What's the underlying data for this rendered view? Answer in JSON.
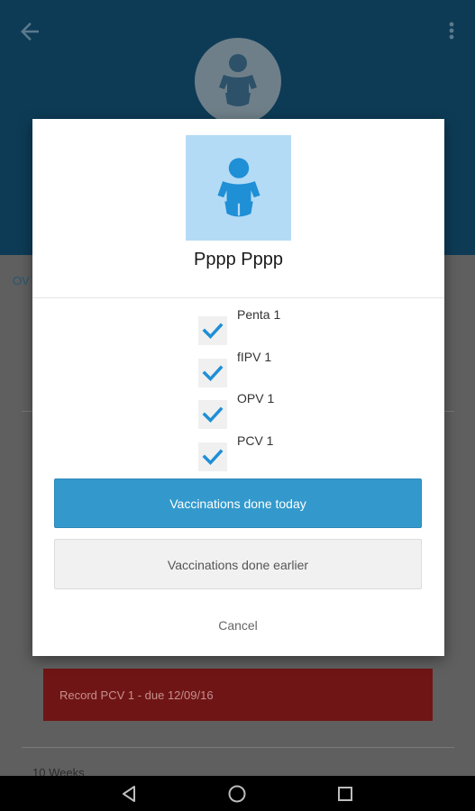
{
  "child": {
    "name": "Pppp Pppp"
  },
  "background": {
    "tab_stub": "OV",
    "record_card": "Record PCV 1 - due 12/09/16",
    "weeks_label": "10 Weeks"
  },
  "vaccines": [
    {
      "label": "Penta 1",
      "checked": true
    },
    {
      "label": "fIPV 1",
      "checked": true
    },
    {
      "label": "OPV 1",
      "checked": true
    },
    {
      "label": "PCV 1",
      "checked": true
    }
  ],
  "buttons": {
    "today": "Vaccinations done today",
    "earlier": "Vaccinations done earlier",
    "cancel": "Cancel"
  },
  "icons": {
    "back": "back-arrow-icon",
    "more": "more-vert-icon",
    "child": "baby-icon",
    "check": "check-icon",
    "nav_back": "nav-back-icon",
    "nav_home": "nav-home-icon",
    "nav_recents": "nav-recents-icon"
  },
  "colors": {
    "header": "#0d3b56",
    "accent": "#3399cc",
    "check": "#1f8fd6",
    "avatar_bg": "#b4dbf5",
    "record_card": "#701515"
  }
}
